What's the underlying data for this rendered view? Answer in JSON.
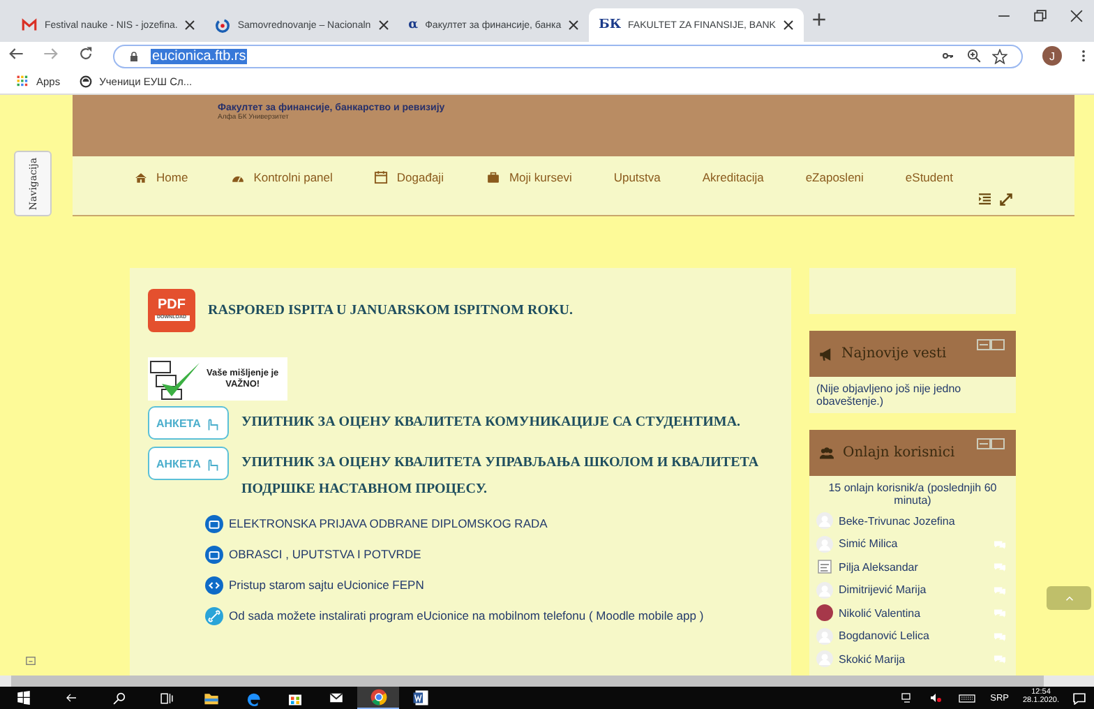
{
  "browser": {
    "tabs": [
      {
        "title": "Festival nauke - NIS - jozefina.",
        "selected": false
      },
      {
        "title": "Samovrednovanje – Nacionaln",
        "selected": false
      },
      {
        "title": "Факултет за финансије, банка",
        "icon_text": "α",
        "selected": false
      },
      {
        "title": "FAKULTET ZA FINANSIJE, BANK",
        "icon_text": "БК",
        "selected": true
      }
    ],
    "address": "eucionica.ftb.rs",
    "avatar_letter": "J",
    "bookmarks": [
      {
        "label": "Apps"
      },
      {
        "label": "Ученици ЕУШ Сл..."
      }
    ]
  },
  "page": {
    "side_tab": "Navigacija",
    "header": {
      "title": "Факултет за финансије, банкарство и ревизију",
      "subtitle": "Алфа БК Универзитет"
    },
    "nav": [
      {
        "label": "Home"
      },
      {
        "label": "Kontrolni panel"
      },
      {
        "label": "Događaji"
      },
      {
        "label": "Moji kursevi"
      },
      {
        "label": "Uputstva"
      },
      {
        "label": "Akreditacija"
      },
      {
        "label": "eZaposleni"
      },
      {
        "label": "eStudent"
      }
    ],
    "main": [
      {
        "kind": "pdf",
        "badge": "PDF",
        "badge_sub": "DOWNLOAD",
        "text": "RASPORED ISPITA U JANUARSKOM ISPITNOM ROKU."
      },
      {
        "kind": "opinion",
        "text": "Vaše mišljenje je",
        "strong": "VAŽNO!"
      },
      {
        "kind": "survey",
        "badge": "АНКЕТА",
        "text": "УПИТНИК ЗА ОЦЕНУ КВАЛИТЕТА КОМУНИКАЦИЈЕ СА СТУДЕНТИМА."
      },
      {
        "kind": "survey",
        "badge": "АНКЕТА",
        "text": "УПИТНИК ЗА ОЦЕНУ КВАЛИТЕТА УПРАВЉАЊА ШКОЛОМ И КВАЛИТЕТА ПОДРШКЕ  НАСТАВНОМ ПРОЦЕСУ."
      },
      {
        "kind": "folder",
        "text": "ELEKTRONSKA PRIJAVA ODBRANE DIPLOMSKOG RADA"
      },
      {
        "kind": "folder",
        "text": "OBRASCI , UPUTSTVA I POTVRDE"
      },
      {
        "kind": "code",
        "text": "Pristup starom sajtu eUcionice FEPN"
      },
      {
        "kind": "link",
        "text": "Od sada možete instalirati program eUcionice na mobilnom telefonu ( Moodle mobile app )"
      }
    ],
    "news": {
      "title": "Najnovije vesti",
      "text": "(Nije objavljeno još nije jedno obaveštenje.)"
    },
    "online": {
      "title": "Onlajn korisnici",
      "summary": "15 onlajn korisnik/a (poslednjih 60 minuta)",
      "users": [
        {
          "name": "Beke-Trivunac Jozefina",
          "message": false
        },
        {
          "name": "Simić Milica",
          "message": true
        },
        {
          "name": "Pilja Aleksandar",
          "message": true
        },
        {
          "name": "Dimitrijević Marija",
          "message": true
        },
        {
          "name": "Nikolić Valentina",
          "message": true
        },
        {
          "name": "Bogdanović Lelica",
          "message": true
        },
        {
          "name": "Skokić Marija",
          "message": true
        }
      ]
    }
  },
  "taskbar": {
    "apps": [
      {
        "active": false
      },
      {
        "active": false
      },
      {
        "active": false
      },
      {
        "active": false
      },
      {
        "active": true
      },
      {
        "active": false
      }
    ],
    "language": "SRP",
    "time": "12:54",
    "date": "28.1.2020."
  }
}
